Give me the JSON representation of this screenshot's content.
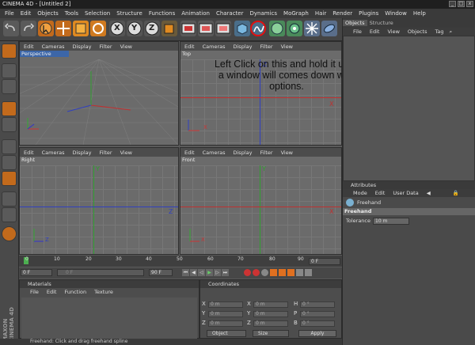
{
  "window": {
    "title": "CINEMA 4D - [Untitled 2]",
    "min": "_",
    "max": "□",
    "close": "x"
  },
  "menu": [
    "File",
    "Edit",
    "Objects",
    "Tools",
    "Selection",
    "Structure",
    "Functions",
    "Animation",
    "Character",
    "Dynamics",
    "MoGraph",
    "Hair",
    "Render",
    "Plugins",
    "Window",
    "Help"
  ],
  "toolbar": {
    "x_label": "X",
    "y_label": "Y",
    "z_label": "Z"
  },
  "viewport_menu": {
    "edit": "Edit",
    "cameras": "Cameras",
    "display": "Display",
    "filter": "Filter",
    "view": "View"
  },
  "viewports": {
    "perspective": "Perspective",
    "top": "Top",
    "right": "Right",
    "front": "Front"
  },
  "axis": {
    "x": "X",
    "y": "Y",
    "z": "Z"
  },
  "annotation": {
    "line1": "Left Click on this and hold it untill",
    "line2": "a window will comes down with",
    "line3": "options."
  },
  "objects_panel": {
    "tab1": "Objects",
    "tab2": "Structure",
    "menu": [
      "File",
      "Edit",
      "View",
      "Objects",
      "Tag"
    ]
  },
  "attributes_panel": {
    "tab": "Attributes",
    "menu": [
      "Mode",
      "Edit",
      "User Data"
    ],
    "object": "Freehand",
    "section": "Freehand",
    "tolerance_label": "Tolerance",
    "tolerance_value": "10 m"
  },
  "timeline": {
    "ticks": [
      "0",
      "10",
      "20",
      "30",
      "40",
      "50",
      "60",
      "70",
      "80",
      "90"
    ],
    "end_frame": "0 F",
    "start_field": "0 F",
    "current_field": "0 F",
    "end_field": "90 F"
  },
  "materials_panel": {
    "title": "Materials",
    "menu": [
      "File",
      "Edit",
      "Function",
      "Texture"
    ]
  },
  "coordinates_panel": {
    "title": "Coordinates",
    "x": "X",
    "y": "Y",
    "z": "Z",
    "h": "H",
    "p": "P",
    "b": "B",
    "pos": [
      "0 m",
      "0 m",
      "0 m"
    ],
    "size": [
      "0 m",
      "0 m",
      "0 m"
    ],
    "rot": [
      "0 °",
      "0 °",
      "0 °"
    ],
    "mode": "Object",
    "size_mode": "Size",
    "apply": "Apply"
  },
  "status": "Freehand: Click and drag freehand spline",
  "brand": "MAXON CINEMA 4D"
}
